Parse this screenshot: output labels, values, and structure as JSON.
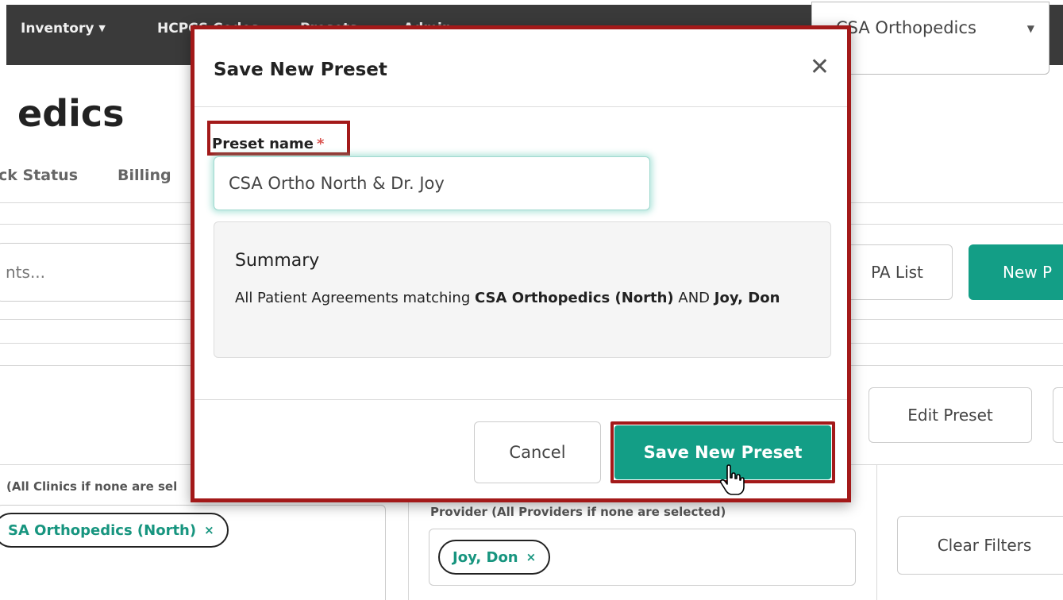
{
  "nav": {
    "items": [
      {
        "label": "Inventory",
        "has_caret": true
      },
      {
        "label": "HCPCS Codes"
      },
      {
        "label": "Presets"
      },
      {
        "label": "Admin"
      }
    ],
    "clinic_select": {
      "value": "CSA Orthopedics"
    }
  },
  "page": {
    "title": "edics",
    "subnav": [
      "ck Status",
      "Billing"
    ],
    "search_placeholder": "nts...",
    "buttons": {
      "pa_list": "PA List",
      "new": "New P",
      "edit_preset": "Edit Preset",
      "clear_filters": "Clear Filters"
    },
    "clinic_filter": {
      "label": "(All Clinics if none are sel",
      "chip": "SA Orthopedics (North)"
    },
    "provider_filter": {
      "label": "Provider (All Providers if none are selected)",
      "chip": "Joy, Don"
    }
  },
  "modal": {
    "title": "Save New Preset",
    "field_label": "Preset name",
    "required_mark": "*",
    "input_value": "CSA Ortho North & Dr. Joy",
    "summary": {
      "title": "Summary",
      "prefix": "All Patient Agreements matching",
      "clinic": "CSA Orthopedics (North)",
      "joiner": "AND",
      "provider": "Joy, Don"
    },
    "cancel_label": "Cancel",
    "save_label": "Save New Preset"
  },
  "colors": {
    "accent": "#139e86",
    "highlight": "#a31919",
    "nav_bg": "#3a3a3a"
  }
}
